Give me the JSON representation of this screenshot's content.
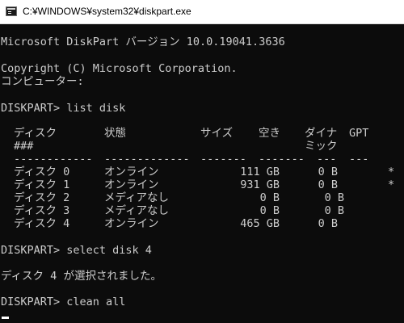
{
  "window": {
    "title": "C:¥WINDOWS¥system32¥diskpart.exe"
  },
  "console": {
    "version_line": "Microsoft DiskPart バージョン 10.0.19041.3636",
    "copyright_line": "Copyright (C) Microsoft Corporation.",
    "computer_line": "コンピューター:",
    "command_list": "DISKPART> list disk",
    "table": {
      "headers": {
        "disk": "ディスク",
        "disk_num": "###",
        "status": "状態",
        "size": "サイズ",
        "free": "空き",
        "dyn_1": "ダイナ",
        "dyn_2": "ミック",
        "gpt": "GPT"
      },
      "separators": {
        "disk": "------------",
        "status": "-------------",
        "size": "-------",
        "free": "-------",
        "dyn": "---",
        "gpt": "---"
      },
      "rows": [
        {
          "disk": "ディスク 0",
          "status": "オンライン",
          "size": "111 GB",
          "free": "0 B",
          "dyn": "",
          "gpt": "*"
        },
        {
          "disk": "ディスク 1",
          "status": "オンライン",
          "size": "931 GB",
          "free": "0 B",
          "dyn": "",
          "gpt": "*"
        },
        {
          "disk": "ディスク 2",
          "status": "メディアなし",
          "size": "0 B",
          "free": "0 B",
          "dyn": "",
          "gpt": ""
        },
        {
          "disk": "ディスク 3",
          "status": "メディアなし",
          "size": "0 B",
          "free": "0 B",
          "dyn": "",
          "gpt": ""
        },
        {
          "disk": "ディスク 4",
          "status": "オンライン",
          "size": "465 GB",
          "free": "0 B",
          "dyn": "",
          "gpt": ""
        }
      ]
    },
    "command_select": "DISKPART> select disk 4",
    "select_result": "ディスク 4 が選択されました。",
    "command_clean": "DISKPART> clean all"
  }
}
